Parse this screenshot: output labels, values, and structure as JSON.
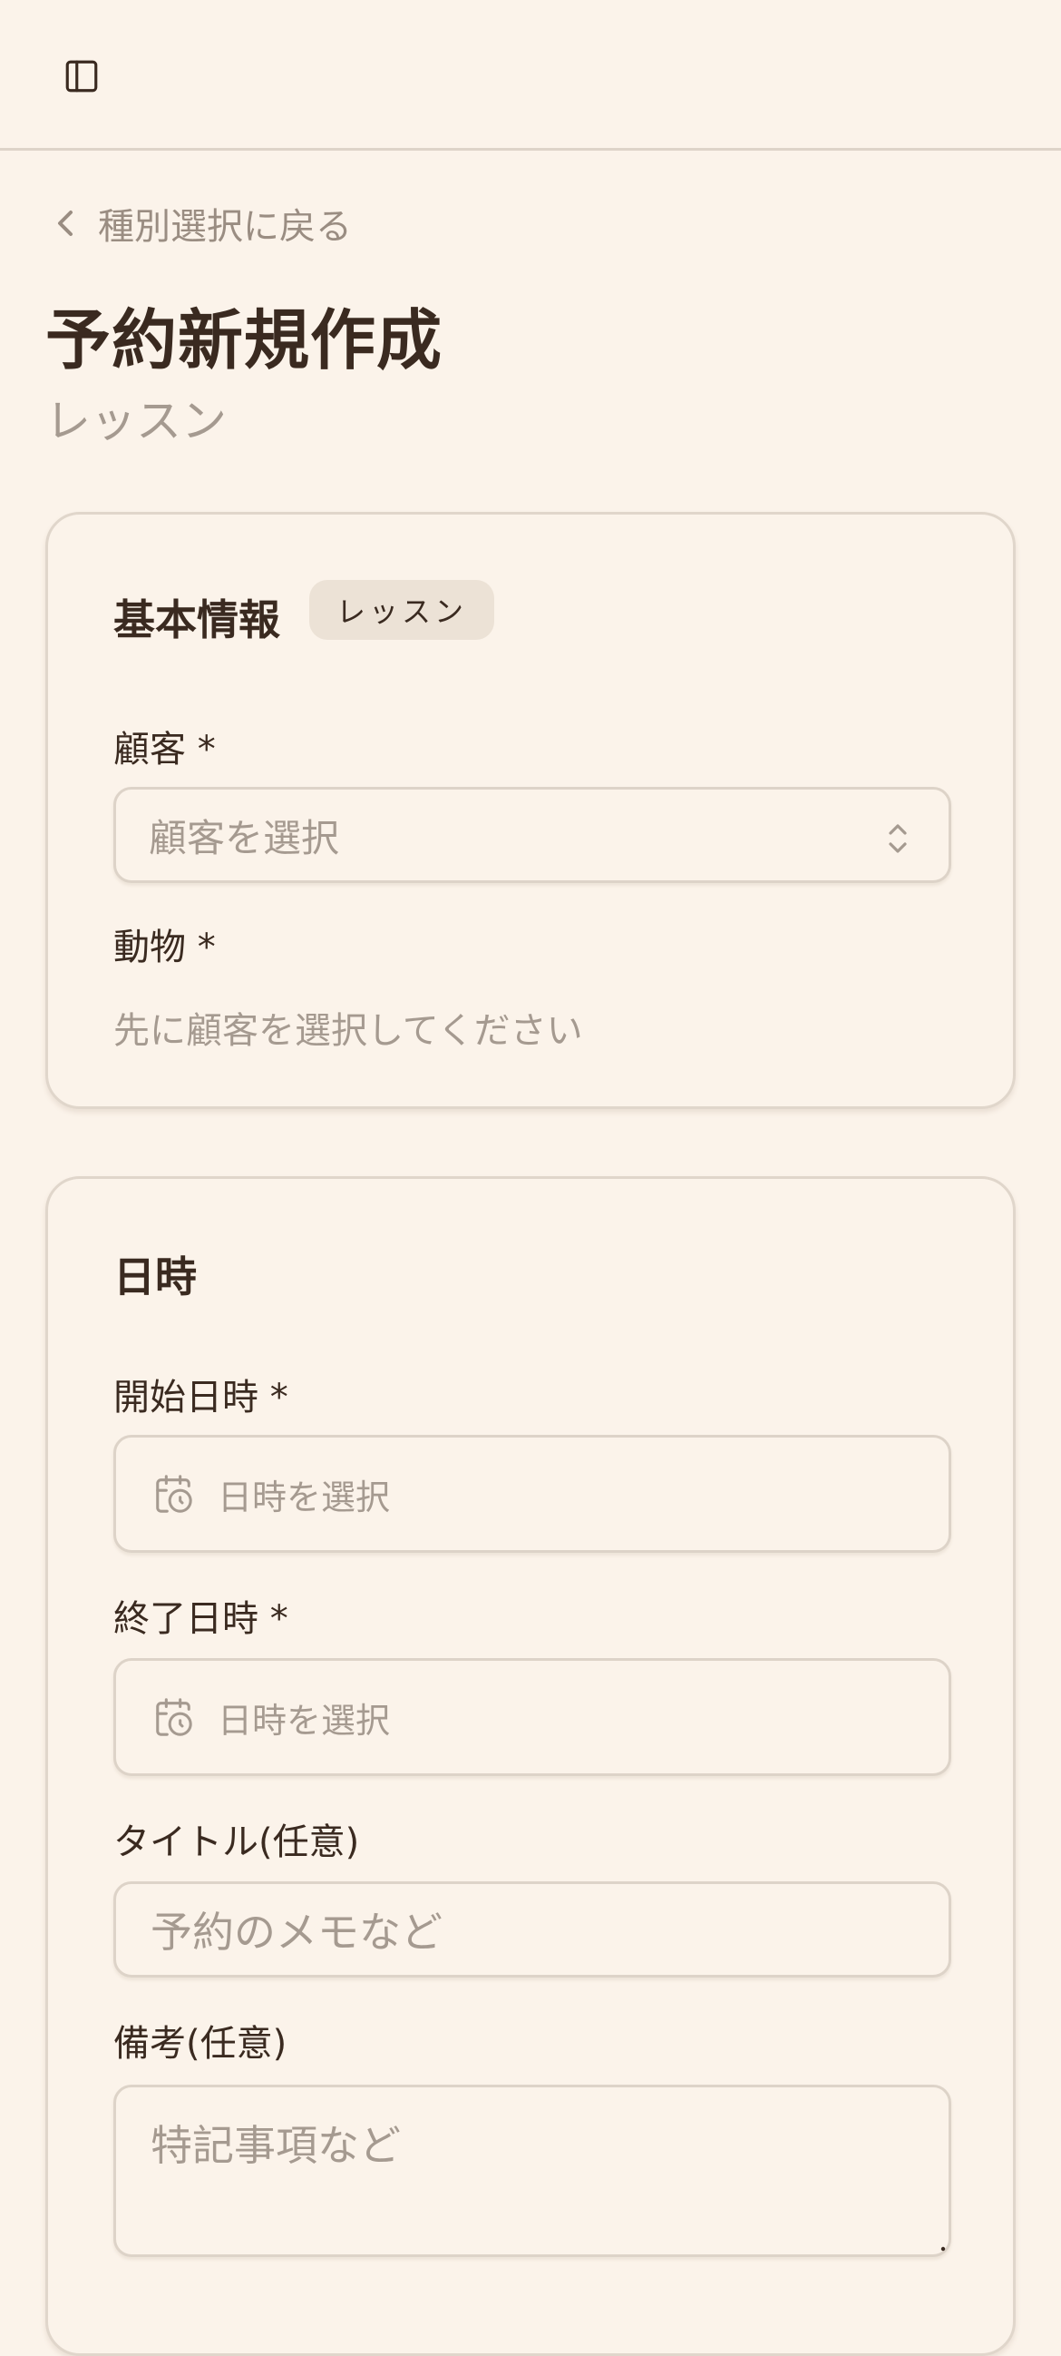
{
  "header": {
    "sidebar_icon": "sidebar-toggle-icon"
  },
  "back_link": {
    "label": "種別選択に戻る",
    "icon": "chevron-left-icon"
  },
  "page": {
    "title": "予約新規作成",
    "subtitle": "レッスン"
  },
  "basic_info": {
    "title": "基本情報",
    "badge": "レッスン",
    "customer_label": "顧客 *",
    "customer_placeholder": "顧客を選択",
    "animal_label": "動物 *",
    "animal_hint": "先に顧客を選択してください"
  },
  "datetime": {
    "title": "日時",
    "start_label": "開始日時 *",
    "start_placeholder": "日時を選択",
    "end_label": "終了日時 *",
    "end_placeholder": "日時を選択",
    "title_label": "タイトル(任意)",
    "title_placeholder": "予約のメモなど",
    "notes_label": "備考(任意)",
    "notes_placeholder": "特記事項など"
  },
  "colors": {
    "background": "#fbf3ea",
    "text": "#3a2a20",
    "muted": "#a59a90",
    "border": "#ddd3c8",
    "badge_bg": "#ece2d6"
  }
}
